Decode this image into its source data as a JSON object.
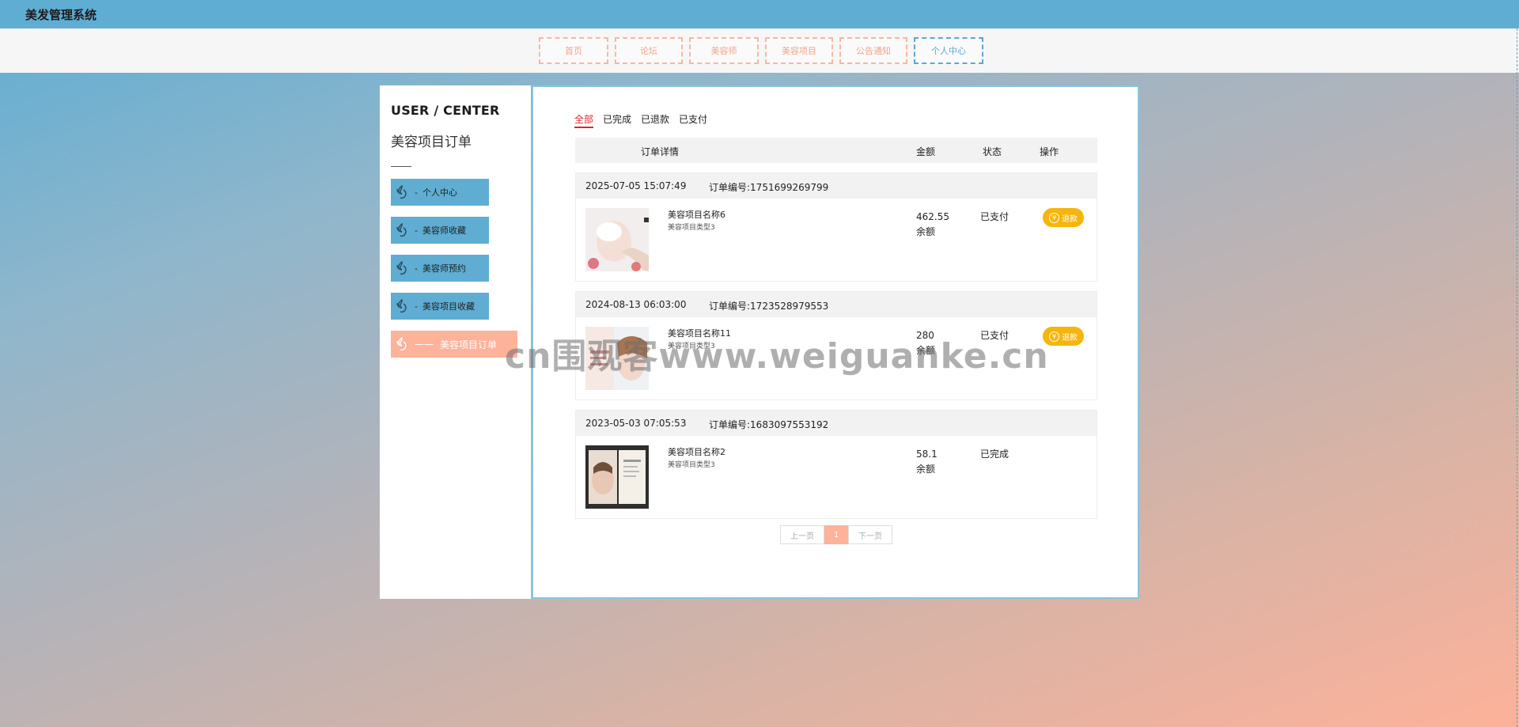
{
  "app": {
    "title": "美发管理系统"
  },
  "nav": {
    "items": [
      {
        "label": "首页"
      },
      {
        "label": "论坛"
      },
      {
        "label": "美容师"
      },
      {
        "label": "美容项目"
      },
      {
        "label": "公告通知"
      },
      {
        "label": "个人中心",
        "active": true
      }
    ]
  },
  "sidebar": {
    "heading": "USER / CENTER",
    "title": "美容项目订单",
    "items": [
      {
        "label": "个人中心",
        "prefix": "-"
      },
      {
        "label": "美容师收藏",
        "prefix": "-"
      },
      {
        "label": "美容师预约",
        "prefix": "-"
      },
      {
        "label": "美容项目收藏",
        "prefix": "-"
      },
      {
        "label": "美容项目订单",
        "prefix": "——",
        "active": true
      }
    ]
  },
  "tabs": [
    {
      "label": "全部",
      "active": true
    },
    {
      "label": "已完成"
    },
    {
      "label": "已退款"
    },
    {
      "label": "已支付"
    }
  ],
  "table_headers": {
    "detail": "订单详情",
    "amount": "金额",
    "status": "状态",
    "action": "操作"
  },
  "orders": [
    {
      "time": "2025-07-05 15:07:49",
      "order_no": "订单编号:1751699269799",
      "item_name": "美容项目名称6",
      "item_type": "美容项目类型3",
      "amount": "462.55",
      "pay_method": "余额",
      "status": "已支付",
      "action": "退款"
    },
    {
      "time": "2024-08-13 06:03:00",
      "order_no": "订单编号:1723528979553",
      "item_name": "美容项目名称11",
      "item_type": "美容项目类型3",
      "amount": "280",
      "pay_method": "余额",
      "status": "已支付",
      "action": "退款"
    },
    {
      "time": "2023-05-03 07:05:53",
      "order_no": "订单编号:1683097553192",
      "item_name": "美容项目名称2",
      "item_type": "美容项目类型3",
      "amount": "58.1",
      "pay_method": "余额",
      "status": "已完成"
    }
  ],
  "pager": {
    "prev": "上一页",
    "current": "1",
    "next": "下一页"
  },
  "watermark": "cn围观客www.weiguanke.cn",
  "colors": {
    "topbar": "#5fadd2",
    "accent": "#fdb29a",
    "refund": "#f6b50c",
    "active_tab": "#d9272e"
  }
}
